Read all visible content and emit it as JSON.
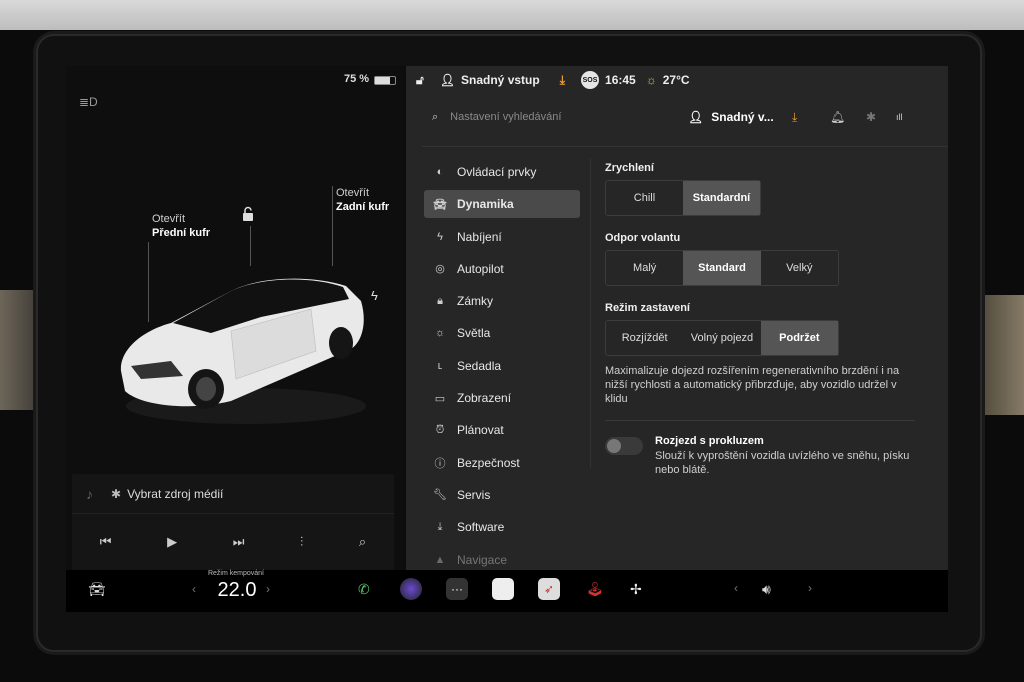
{
  "status": {
    "battery_pct": "75 %",
    "profile": "Snadný vstup",
    "sos": "SOS",
    "time": "16:45",
    "temperature": "27°C"
  },
  "left_panel": {
    "front_trunk": {
      "action": "Otevřít",
      "name": "Přední kufr"
    },
    "rear_trunk": {
      "action": "Otevřít",
      "name": "Zadní kufr"
    },
    "media": {
      "source_label": "Vybrat zdroj médií"
    }
  },
  "search": {
    "placeholder": "Nastavení vyhledávání",
    "user": "Snadný v..."
  },
  "menu": [
    {
      "label": "Ovládací prvky",
      "icon": "toggle-icon"
    },
    {
      "label": "Dynamika",
      "icon": "car-icon"
    },
    {
      "label": "Nabíjení",
      "icon": "bolt-icon"
    },
    {
      "label": "Autopilot",
      "icon": "steering-wheel-icon"
    },
    {
      "label": "Zámky",
      "icon": "lock-icon"
    },
    {
      "label": "Světla",
      "icon": "sun-icon"
    },
    {
      "label": "Sedadla",
      "icon": "seat-icon"
    },
    {
      "label": "Zobrazení",
      "icon": "display-icon"
    },
    {
      "label": "Plánovat",
      "icon": "alarm-clock-icon"
    },
    {
      "label": "Bezpečnost",
      "icon": "alert-circle-icon"
    },
    {
      "label": "Servis",
      "icon": "wrench-icon"
    },
    {
      "label": "Software",
      "icon": "download-icon"
    },
    {
      "label": "Navigace",
      "icon": "navigation-icon"
    }
  ],
  "settings": {
    "acceleration": {
      "title": "Zrychlení",
      "options": [
        "Chill",
        "Standardní"
      ],
      "selected": "Standardní"
    },
    "steering": {
      "title": "Odpor volantu",
      "options": [
        "Malý",
        "Standard",
        "Velký"
      ],
      "selected": "Standard"
    },
    "stopping": {
      "title": "Režim zastavení",
      "options": [
        "Rozjíždět",
        "Volný pojezd",
        "Podržet"
      ],
      "selected": "Podržet",
      "description": "Maximalizuje dojezd rozšířením regenerativního brzdění i na nižší rychlosti a automatický přibrzďuje, aby vozidlo udržel v klidu"
    },
    "slip_start": {
      "title": "Rozjezd s prokluzem",
      "description": "Slouží k vyproštění vozidla uvízlého ve sněhu, písku nebo blátě.",
      "enabled": false
    }
  },
  "taskbar": {
    "camp_mode_label": "Režim kempování",
    "temperature": "22.0"
  },
  "colors": {
    "accent_orange": "#f0a030",
    "panel_bg": "#262626",
    "selected_bg": "#555555"
  }
}
